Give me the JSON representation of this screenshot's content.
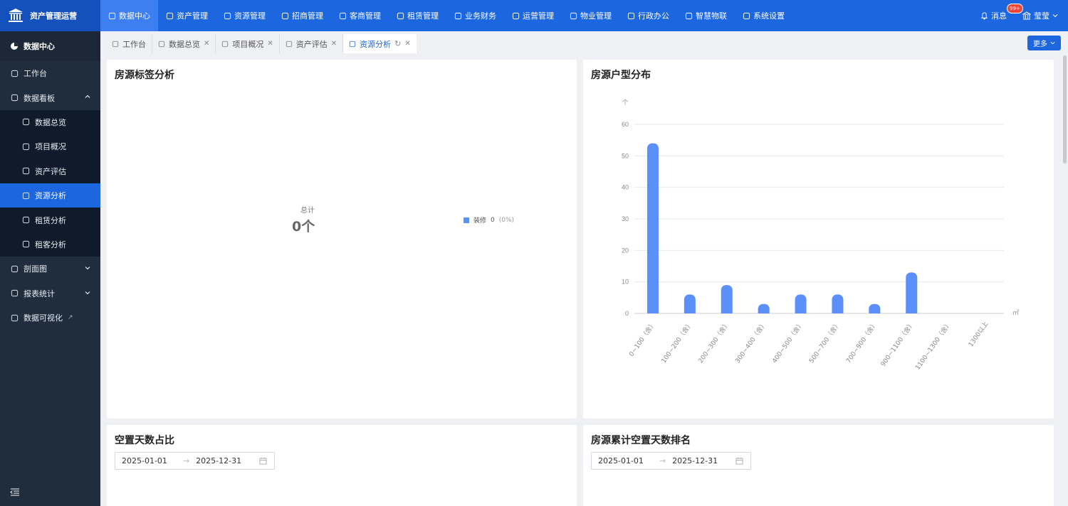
{
  "app": {
    "title": "资产管理运营"
  },
  "topnav": [
    {
      "label": "数据中心",
      "icon": "pie-chart-icon",
      "active": true
    },
    {
      "label": "资产管理",
      "icon": "cube-icon"
    },
    {
      "label": "资源管理",
      "icon": "building-icon"
    },
    {
      "label": "招商管理",
      "icon": "tag-icon"
    },
    {
      "label": "客商管理",
      "icon": "users-icon"
    },
    {
      "label": "租赁管理",
      "icon": "home-icon"
    },
    {
      "label": "业务财务",
      "icon": "coin-icon"
    },
    {
      "label": "运营管理",
      "icon": "chart-icon"
    },
    {
      "label": "物业管理",
      "icon": "house-icon"
    },
    {
      "label": "行政办公",
      "icon": "monitor-icon"
    },
    {
      "label": "智慧物联",
      "icon": "atom-icon"
    },
    {
      "label": "系统设置",
      "icon": "gear-icon"
    }
  ],
  "topright": {
    "messages": "消息",
    "badge": "99+",
    "user": "莹莹"
  },
  "sidebar": {
    "header": "数据中心",
    "items": [
      {
        "label": "工作台",
        "icon": "dashboard-icon",
        "level": 1
      },
      {
        "label": "数据看板",
        "icon": "board-icon",
        "level": 1,
        "expanded": true
      },
      {
        "label": "数据总览",
        "icon": "bar-icon",
        "level": 2
      },
      {
        "label": "项目概况",
        "icon": "monitor-icon",
        "level": 2
      },
      {
        "label": "资产评估",
        "icon": "chart-icon",
        "level": 2
      },
      {
        "label": "资源分析",
        "icon": "analysis-icon",
        "level": 2,
        "active": true
      },
      {
        "label": "租赁分析",
        "icon": "house-icon",
        "level": 2
      },
      {
        "label": "租客分析",
        "icon": "person-icon",
        "level": 2
      },
      {
        "label": "剖面图",
        "icon": "cube-icon",
        "level": 1,
        "collapsible": true
      },
      {
        "label": "报表统计",
        "icon": "report-icon",
        "level": 1,
        "collapsible": true
      },
      {
        "label": "数据可视化",
        "icon": "visual-icon",
        "level": 1,
        "external": true
      }
    ]
  },
  "tabs": [
    {
      "label": "工作台",
      "closable": false
    },
    {
      "label": "数据总览",
      "closable": true
    },
    {
      "label": "项目概况",
      "closable": true
    },
    {
      "label": "资产评估",
      "closable": true
    },
    {
      "label": "资源分析",
      "closable": true,
      "active": true
    }
  ],
  "more_label": "更多",
  "cards": {
    "tag_analysis": {
      "title": "房源标签分析",
      "total_label": "总计",
      "total_value": "0个",
      "legend": {
        "name": "装修",
        "value": "0",
        "pct": "(0%)"
      }
    },
    "layout_dist": {
      "title": "房源户型分布"
    },
    "vacancy_ratio": {
      "title": "空置天数占比",
      "start": "2025-01-01",
      "end": "2025-12-31"
    },
    "vacancy_rank": {
      "title": "房源累计空置天数排名",
      "start": "2025-01-01",
      "end": "2025-12-31"
    }
  },
  "chart_data": {
    "type": "bar",
    "title": "房源户型分布",
    "ylabel": "个",
    "xlabel": "㎡",
    "categories": [
      "0~100（含）",
      "100~200（含）",
      "200~300（含）",
      "300~400（含）",
      "400~500（含）",
      "500~700（含）",
      "700~900（含）",
      "900~1100（含）",
      "1100~1300（含）",
      "1300以上"
    ],
    "values": [
      54,
      6,
      9,
      3,
      6,
      6,
      3,
      13,
      0,
      0
    ],
    "ylim": [
      0,
      60
    ],
    "yticks": [
      0,
      10,
      20,
      30,
      40,
      50,
      60
    ],
    "grid": true,
    "color": "#5b8ff9"
  }
}
